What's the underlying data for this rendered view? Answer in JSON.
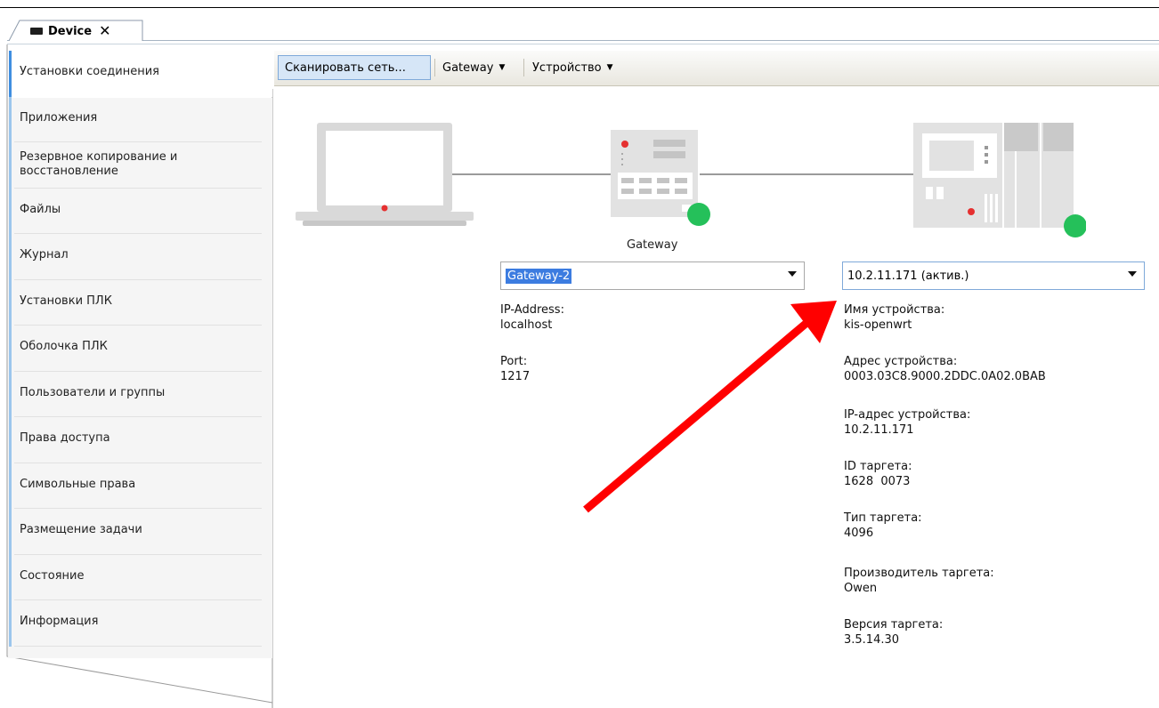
{
  "tab": {
    "title": "Device",
    "close_glyph": "✕",
    "icon": "device-icon"
  },
  "sidebar": {
    "items": [
      {
        "label": "Установки соединения"
      },
      {
        "label": "Приложения"
      },
      {
        "label": "Резервное копирование и восстановление"
      },
      {
        "label": "Файлы"
      },
      {
        "label": "Журнал"
      },
      {
        "label": "Установки ПЛК"
      },
      {
        "label": "Оболочка ПЛК"
      },
      {
        "label": "Пользователи и группы"
      },
      {
        "label": "Права доступа"
      },
      {
        "label": "Символьные права"
      },
      {
        "label": "Размещение задачи"
      },
      {
        "label": "Состояние"
      },
      {
        "label": "Информация"
      }
    ]
  },
  "toolbar": {
    "scan_label": "Сканировать сеть...",
    "gateway_label": "Gateway",
    "device_label": "Устройство"
  },
  "diagram": {
    "gateway_caption": "Gateway"
  },
  "gateway": {
    "selected": "Gateway-2",
    "ip_label": "IP-Address:",
    "ip_value": "localhost",
    "port_label": "Port:",
    "port_value": "1217"
  },
  "device": {
    "selected": "10.2.11.171 (актив.)",
    "fields": [
      {
        "label": "Имя устройства:",
        "value": "kis-openwrt"
      },
      {
        "label": "Адрес устройства:",
        "value": "0003.03C8.9000.2DDC.0A02.0BAB"
      },
      {
        "label": "IP-адрес устройства:",
        "value": "10.2.11.171"
      },
      {
        "label": "ID таргета:",
        "value": "1628  0073"
      },
      {
        "label": "Тип таргета:",
        "value": "4096"
      },
      {
        "label": "Производитель таргета:",
        "value": "Owen"
      },
      {
        "label": "Версия таргета:",
        "value": "3.5.14.30"
      }
    ]
  },
  "colors": {
    "status_online": "#25c05a",
    "annotation_arrow": "#ff0000",
    "nav_accent": "#3f8ee0",
    "selection": "#3c7ce0"
  }
}
